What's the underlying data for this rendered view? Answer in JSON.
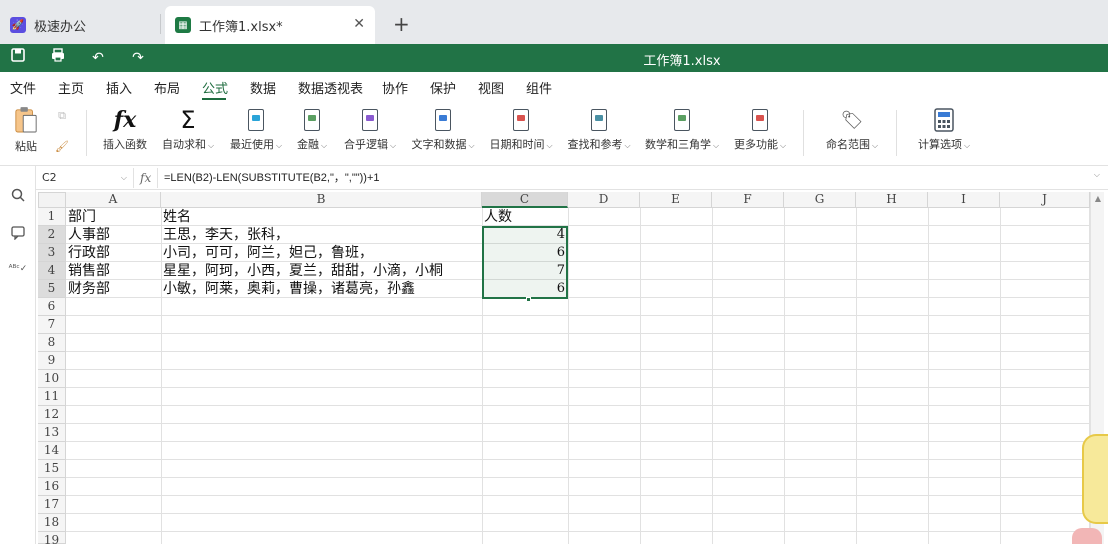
{
  "tabs": [
    {
      "label": "极速办公",
      "icon": "rocket-icon"
    },
    {
      "label": "工作簿1.xlsx*",
      "icon": "spreadsheet-icon",
      "close": "✕"
    }
  ],
  "new_tab": "+",
  "titlebar": {
    "title": "工作簿1.xlsx",
    "color": "#217346"
  },
  "menu": {
    "items": [
      "文件",
      "主页",
      "插入",
      "布局",
      "公式",
      "数据",
      "数据透视表",
      "协作",
      "保护",
      "视图",
      "组件"
    ],
    "active": "公式"
  },
  "ribbon": {
    "paste": "粘贴",
    "insert_function": "插入函数",
    "autosum": "自动求和",
    "recent": "最近使用",
    "financial": "金融",
    "logical": "合乎逻辑",
    "text_data": "文字和数据",
    "date_time": "日期和时间",
    "lookup": "查找和参考",
    "math_trig": "数学和三角学",
    "more": "更多功能",
    "named_range": "命名范围",
    "calc_options": "计算选项"
  },
  "formula_bar": {
    "cell_ref": "C2",
    "fx": "fx",
    "formula": "=LEN(B2)-LEN(SUBSTITUTE(B2,\"，\",\"\"))+1"
  },
  "sheet": {
    "columns": [
      "A",
      "B",
      "C",
      "D",
      "E",
      "F",
      "G",
      "H",
      "I",
      "J"
    ],
    "rows": [
      "1",
      "2",
      "3",
      "4",
      "5",
      "6",
      "7",
      "8",
      "9",
      "10",
      "11",
      "12",
      "13",
      "14",
      "15",
      "16",
      "17",
      "18",
      "19"
    ],
    "selected_column": "C",
    "cells": {
      "A1": "部门",
      "B1": "姓名",
      "C1": "人数",
      "A2": "人事部",
      "B2": "王思，李天，张科，",
      "C2": "4",
      "A3": "行政部",
      "B3": "小司，可可，阿兰，妲己，鲁班，",
      "C3": "6",
      "A4": "销售部",
      "B4": "星星，阿珂，小西，夏兰，甜甜，小滴，小桐",
      "C4": "7",
      "A5": "财务部",
      "B5": "小敏，阿莱，奥莉，曹操，诸葛亮，孙鑫",
      "C5": "6"
    }
  }
}
